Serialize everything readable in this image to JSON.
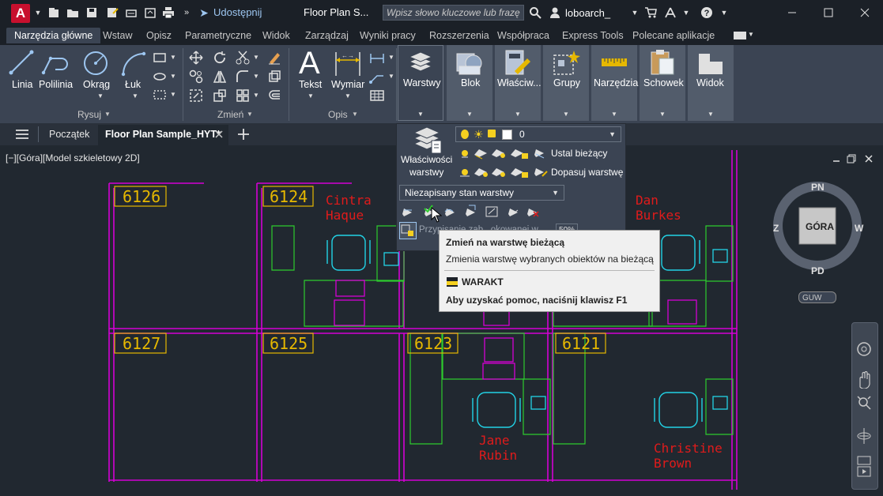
{
  "titlebar": {
    "share_label": "Udostępnij",
    "document_title": "Floor Plan S...",
    "search_placeholder": "Wpisz słowo kluczowe lub frazę",
    "user_name": "loboarch_"
  },
  "ribbon_tabs": [
    "Narzędzia główne",
    "Wstaw",
    "Opisz",
    "Parametryczne",
    "Widok",
    "Zarządzaj",
    "Wyniki pracy",
    "Rozszerzenia",
    "Współpraca",
    "Express Tools",
    "Polecane aplikacje"
  ],
  "ribbon": {
    "draw": {
      "linia": "Linia",
      "polilinia": "Polilinia",
      "okrag": "Okrąg",
      "luk": "Łuk",
      "title": "Rysuj"
    },
    "modify": {
      "title": "Zmień"
    },
    "annotation": {
      "tekst": "Tekst",
      "wymiar": "Wymiar",
      "title": "Opis"
    },
    "big_buttons": {
      "warstwy": "Warstwy",
      "blok": "Blok",
      "wlasciwosci": "Właściw...",
      "grupy": "Grupy",
      "narzedzia": "Narzędzia",
      "schowek": "Schowek",
      "widok": "Widok"
    }
  },
  "file_tabs": {
    "start": "Początek",
    "active": "Floor Plan Sample_HYT*"
  },
  "viewport_label": "[−][Góra][Model szkieletowy 2D]",
  "layers_popup": {
    "props_line1": "Właściwości",
    "props_line2": "warstwy",
    "current_layer": "0",
    "ustal_biezacy": "Ustal bieżący",
    "dopasuj": "Dopasuj warstwę",
    "state_combo": "Niezapisany stan warstwy",
    "ghost_text": "Przypisanie zab...okowanej w...",
    "percent": "50%"
  },
  "tooltip": {
    "title": "Zmień na warstwę bieżącą",
    "description": "Zmienia warstwę wybranych obiektów na bieżącą",
    "command": "WARAKT",
    "help": "Aby uzyskać pomoc, naciśnij klawisz F1"
  },
  "viewcube": {
    "north": "PN",
    "south": "PD",
    "west": "Z",
    "east": "W",
    "face": "GÓRA",
    "wcs": "GUW"
  },
  "rooms": [
    "6126",
    "6124",
    "6127",
    "6125",
    "6123",
    "6121"
  ],
  "occupants": [
    {
      "line1": "Cintra",
      "line2": "Haque"
    },
    {
      "line1": "Dan",
      "line2": "Burkes"
    },
    {
      "line1": "Jane",
      "line2": "Rubin"
    },
    {
      "line1": "Christine",
      "line2": "Brown"
    }
  ],
  "colors": {
    "accent": "#c8102e",
    "walls": "#d400d4",
    "furniture": "#22d3e6",
    "text_yellow": "#e6b800",
    "text_red": "#e01b1b",
    "green": "#2ecc2e"
  }
}
